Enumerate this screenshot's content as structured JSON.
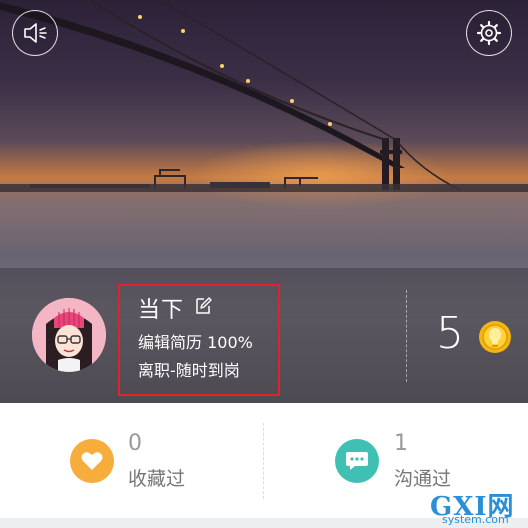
{
  "hero": {
    "sound_icon": "speaker-icon",
    "settings_icon": "gear-icon"
  },
  "profile": {
    "name": "当下",
    "edit_icon": "pencil-edit-icon",
    "resume_progress_text": "编辑简历 100%",
    "job_status": "离职-随时到岗",
    "avatar_icon": "cartoon-girl-avatar"
  },
  "coins": {
    "count": "5",
    "icon": "gold-coin-icon"
  },
  "stats": [
    {
      "count": "0",
      "label": "收藏过",
      "icon": "heart-icon",
      "color": "#f6ad3c"
    },
    {
      "count": "1",
      "label": "沟通过",
      "icon": "chat-bubble-icon",
      "color": "#3fc0b2"
    }
  ],
  "watermark": {
    "logo": "GXI网",
    "domain": "system.com"
  },
  "colors": {
    "highlight_box": "#e0232b"
  }
}
